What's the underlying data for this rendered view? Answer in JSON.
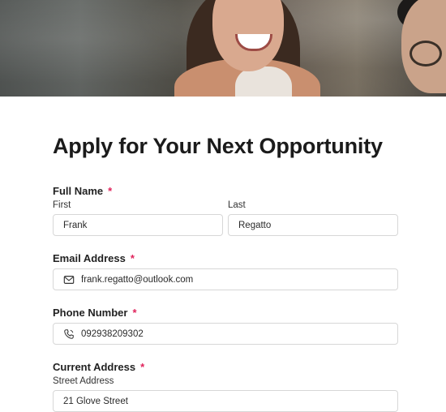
{
  "form": {
    "title": "Apply for Your Next Opportunity",
    "full_name": {
      "label": "Full Name",
      "required_mark": "*",
      "first_label": "First",
      "first_value": "Frank",
      "last_label": "Last",
      "last_value": "Regatto"
    },
    "email": {
      "label": "Email Address",
      "required_mark": "*",
      "value": "frank.regatto@outlook.com",
      "icon": "envelope-icon"
    },
    "phone": {
      "label": "Phone Number",
      "required_mark": "*",
      "value": "092938209302",
      "icon": "phone-icon"
    },
    "address": {
      "label": "Current Address",
      "required_mark": "*",
      "street_label": "Street Address",
      "street_value": "21 Glove Street"
    }
  },
  "colors": {
    "required": "#e0235b",
    "border": "#d7d7d7",
    "text": "#1b1b1b"
  }
}
